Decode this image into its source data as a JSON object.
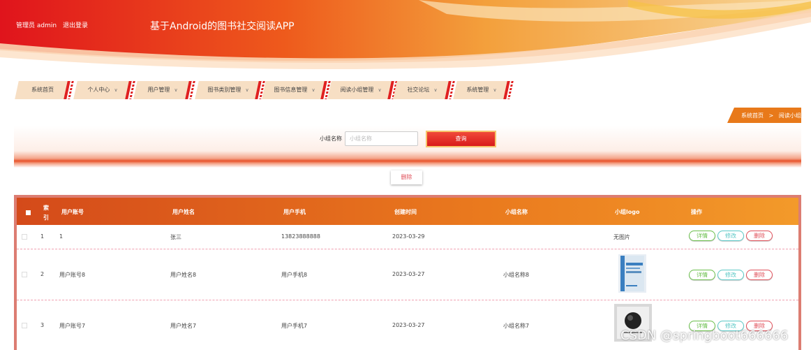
{
  "header": {
    "user_label": "管理员 admin",
    "logout_label": "退出登录",
    "app_title": "基于Android的图书社交阅读APP",
    "colors": {
      "primary": "#e8301e",
      "accent": "#f39a2a",
      "light": "#f7dfc4"
    }
  },
  "nav": {
    "items": [
      {
        "label": "系统首页",
        "has_dropdown": false
      },
      {
        "label": "个人中心",
        "has_dropdown": true
      },
      {
        "label": "用户管理",
        "has_dropdown": true
      },
      {
        "label": "图书类别管理",
        "has_dropdown": true
      },
      {
        "label": "图书信息管理",
        "has_dropdown": true
      },
      {
        "label": "阅读小组管理",
        "has_dropdown": true
      },
      {
        "label": "社交论坛",
        "has_dropdown": true
      },
      {
        "label": "系统管理",
        "has_dropdown": true
      }
    ],
    "dropdown_icon": "chevron-down-icon"
  },
  "breadcrumb": {
    "home": "系统首页",
    "separator": ">",
    "current": "阅读小组"
  },
  "search": {
    "label": "小组名称",
    "placeholder": "小组名称",
    "query_button": "查询"
  },
  "toolbar": {
    "delete_label": "删除"
  },
  "table": {
    "columns": [
      "索引",
      "用户账号",
      "用户姓名",
      "用户手机",
      "创建时间",
      "小组名称",
      "小组logo",
      "操作"
    ],
    "rows": [
      {
        "index": "1",
        "account": "1",
        "name": "张三",
        "phone": "13823888888",
        "created": "2023-03-29",
        "group": "",
        "logo": "无图片"
      },
      {
        "index": "2",
        "account": "用户账号8",
        "name": "用户姓名8",
        "phone": "用户手机8",
        "created": "2023-03-27",
        "group": "小组名称8",
        "logo": ""
      },
      {
        "index": "3",
        "account": "用户账号7",
        "name": "用户姓名7",
        "phone": "用户手机7",
        "created": "2023-03-27",
        "group": "小组名称7",
        "logo": ""
      }
    ],
    "actions": {
      "detail": "详情",
      "edit": "修改",
      "delete": "删除"
    }
  },
  "watermark": "CSDN @springboot666666"
}
